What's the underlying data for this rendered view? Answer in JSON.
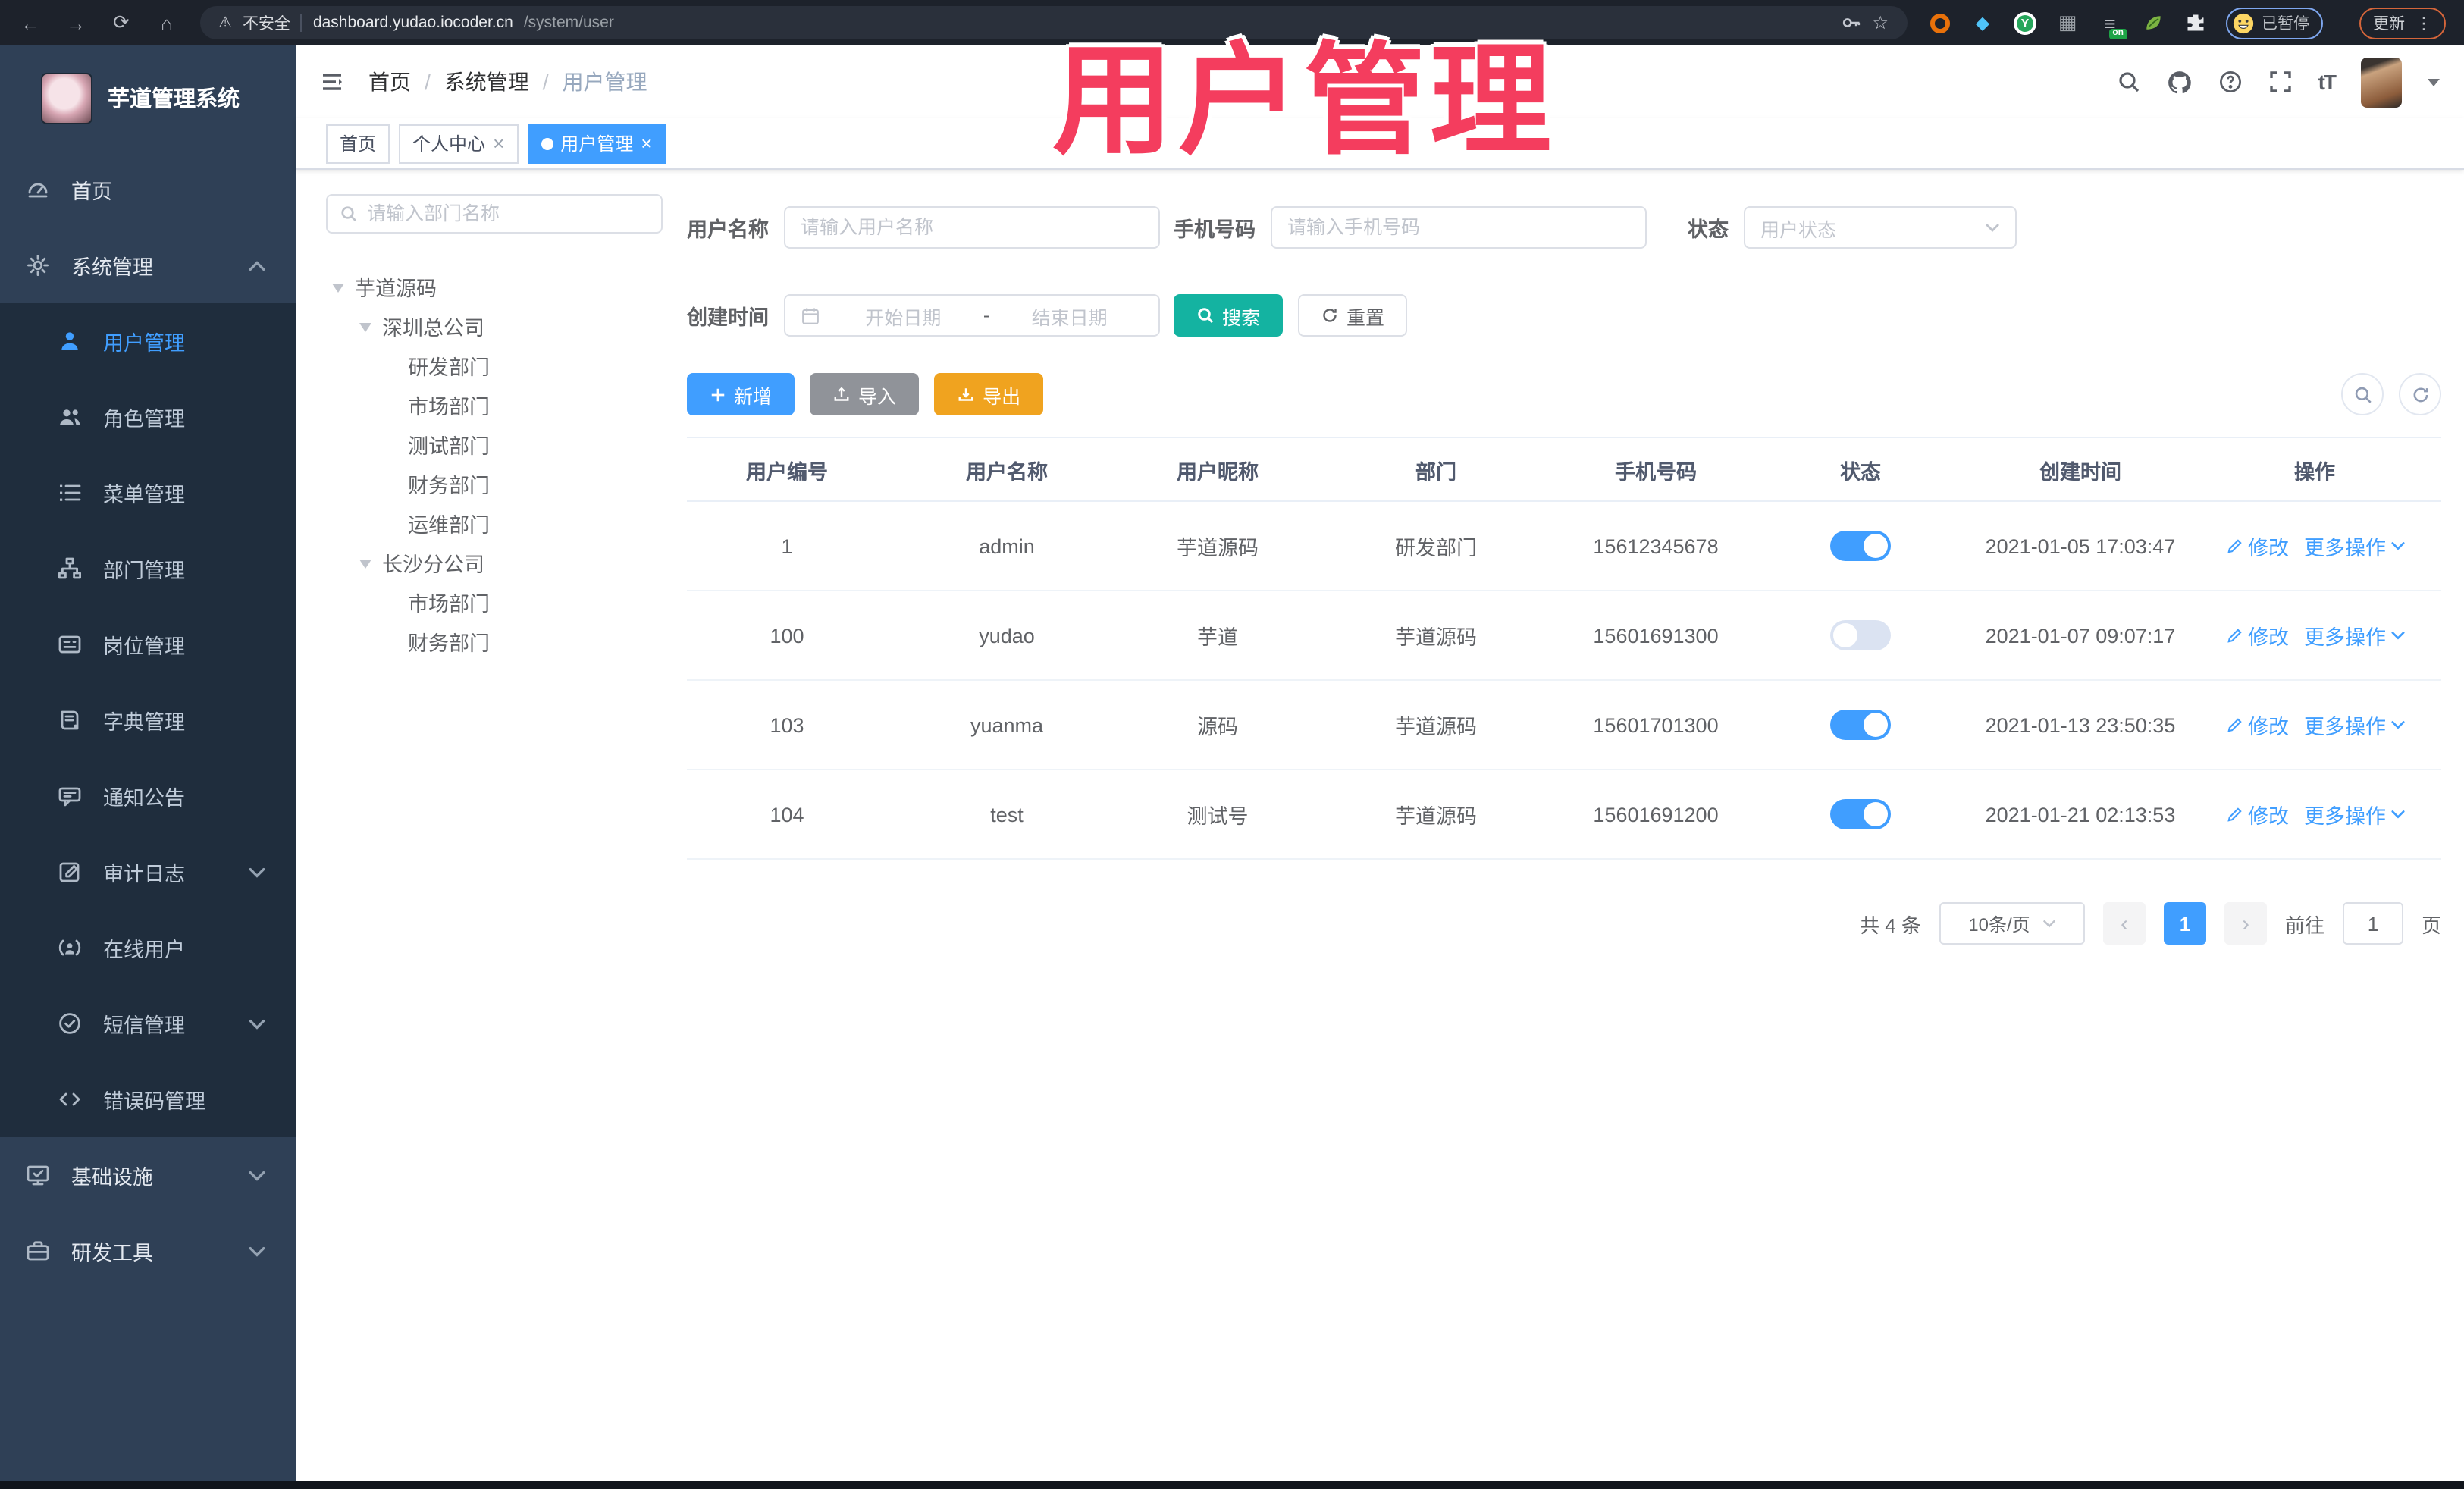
{
  "overlay_title": "用户管理",
  "browser": {
    "security_label": "不安全",
    "url_host": "dashboard.yudao.iocoder.cn",
    "url_path": "/system/user",
    "extension_badge": "on",
    "paused_badge": "已暂停",
    "update_button": "更新"
  },
  "header": {
    "app_title": "芋道管理系统",
    "breadcrumb": [
      "首页",
      "系统管理",
      "用户管理"
    ],
    "font_icon_label": "tT"
  },
  "tabs": [
    {
      "label": "首页",
      "closable": false,
      "active": false
    },
    {
      "label": "个人中心",
      "closable": true,
      "active": false
    },
    {
      "label": "用户管理",
      "closable": true,
      "active": true
    }
  ],
  "sidebar": {
    "items": [
      {
        "label": "首页",
        "icon": "dashboard-icon",
        "type": "top"
      },
      {
        "label": "系统管理",
        "icon": "gear-icon",
        "type": "top",
        "arrow": "up"
      },
      {
        "label": "用户管理",
        "icon": "user-icon",
        "type": "sub",
        "active": true
      },
      {
        "label": "角色管理",
        "icon": "users-icon",
        "type": "sub"
      },
      {
        "label": "菜单管理",
        "icon": "menu-list-icon",
        "type": "sub"
      },
      {
        "label": "部门管理",
        "icon": "org-tree-icon",
        "type": "sub"
      },
      {
        "label": "岗位管理",
        "icon": "id-card-icon",
        "type": "sub"
      },
      {
        "label": "字典管理",
        "icon": "dictionary-icon",
        "type": "sub"
      },
      {
        "label": "通知公告",
        "icon": "announcement-icon",
        "type": "sub"
      },
      {
        "label": "审计日志",
        "icon": "audit-log-icon",
        "type": "sub",
        "arrow": "down"
      },
      {
        "label": "在线用户",
        "icon": "online-user-icon",
        "type": "sub"
      },
      {
        "label": "短信管理",
        "icon": "sms-icon",
        "type": "sub",
        "arrow": "down"
      },
      {
        "label": "错误码管理",
        "icon": "error-code-icon",
        "type": "sub"
      },
      {
        "label": "基础设施",
        "icon": "infrastructure-icon",
        "type": "top",
        "arrow": "down"
      },
      {
        "label": "研发工具",
        "icon": "devtools-icon",
        "type": "top",
        "arrow": "down"
      }
    ]
  },
  "dept_tree": {
    "search_placeholder": "请输入部门名称",
    "nodes": [
      {
        "label": "芋道源码",
        "depth": 0,
        "expandable": true
      },
      {
        "label": "深圳总公司",
        "depth": 1,
        "expandable": true
      },
      {
        "label": "研发部门",
        "depth": 2
      },
      {
        "label": "市场部门",
        "depth": 2
      },
      {
        "label": "测试部门",
        "depth": 2
      },
      {
        "label": "财务部门",
        "depth": 2
      },
      {
        "label": "运维部门",
        "depth": 2
      },
      {
        "label": "长沙分公司",
        "depth": 1,
        "expandable": true
      },
      {
        "label": "市场部门",
        "depth": 2
      },
      {
        "label": "财务部门",
        "depth": 2
      }
    ]
  },
  "filters": {
    "username_label": "用户名称",
    "username_placeholder": "请输入用户名称",
    "mobile_label": "手机号码",
    "mobile_placeholder": "请输入手机号码",
    "status_label": "状态",
    "status_placeholder": "用户状态",
    "created_label": "创建时间",
    "date_start_placeholder": "开始日期",
    "date_separator": "-",
    "date_end_placeholder": "结束日期",
    "search_button": "搜索",
    "reset_button": "重置"
  },
  "toolbar": {
    "add_button": "新增",
    "import_button": "导入",
    "export_button": "导出"
  },
  "table": {
    "headers": [
      "用户编号",
      "用户名称",
      "用户昵称",
      "部门",
      "手机号码",
      "状态",
      "创建时间",
      "操作"
    ],
    "edit_action": "修改",
    "more_action": "更多操作",
    "rows": [
      {
        "id": "1",
        "username": "admin",
        "nickname": "芋道源码",
        "dept": "研发部门",
        "mobile": "15612345678",
        "enabled": true,
        "created": "2021-01-05 17:03:47"
      },
      {
        "id": "100",
        "username": "yudao",
        "nickname": "芋道",
        "dept": "芋道源码",
        "mobile": "15601691300",
        "enabled": false,
        "created": "2021-01-07 09:07:17"
      },
      {
        "id": "103",
        "username": "yuanma",
        "nickname": "源码",
        "dept": "芋道源码",
        "mobile": "15601701300",
        "enabled": true,
        "created": "2021-01-13 23:50:35"
      },
      {
        "id": "104",
        "username": "test",
        "nickname": "测试号",
        "dept": "芋道源码",
        "mobile": "15601691200",
        "enabled": true,
        "created": "2021-01-21 02:13:53"
      }
    ]
  },
  "pagination": {
    "total_text": "共 4 条",
    "page_size": "10条/页",
    "current_page": "1",
    "goto_label": "前往",
    "goto_value": "1",
    "page_unit": "页"
  },
  "colors": {
    "primary": "#409eff",
    "search_teal": "#14b3a1",
    "export_orange": "#f0a31f",
    "import_gray": "#909399",
    "sidebar_bg": "#2f4056",
    "submenu_bg": "#1f2d3d",
    "overlay_pink": "#f43d5e"
  }
}
